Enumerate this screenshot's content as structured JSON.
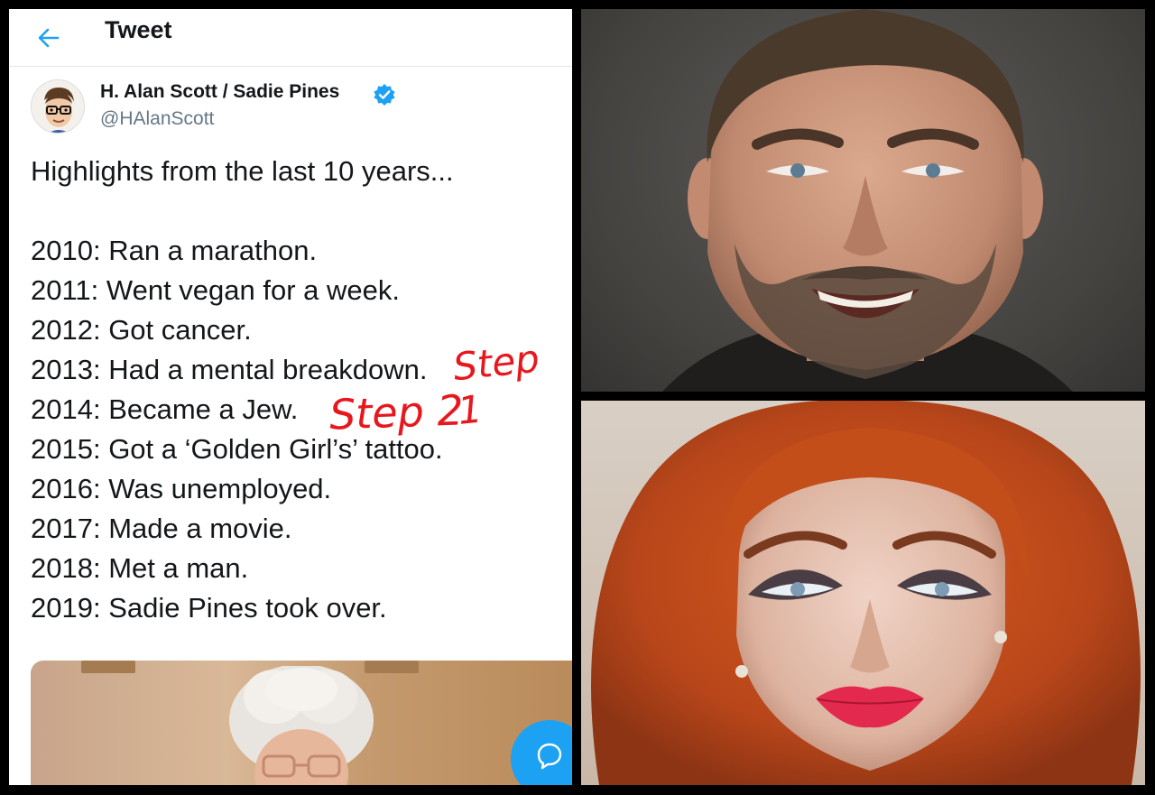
{
  "header": {
    "title": "Tweet"
  },
  "tweet": {
    "display_name": "H. Alan Scott / Sadie Pines",
    "handle": "@HAlanScott",
    "intro": "Highlights from the last 10 years...",
    "lines": [
      "2010: Ran a marathon.",
      "2011: Went vegan for a week.",
      "2012: Got cancer.",
      "2013: Had a mental breakdown.",
      "2014: Became a Jew.",
      "2015: Got a ‘Golden Girl’s’ tattoo.",
      "2016: Was unemployed.",
      "2017: Made a movie.",
      "2018: Met a man.",
      "2019: Sadie Pines took over."
    ]
  },
  "annotations": {
    "step1": "Step 1",
    "step2": "Step 2"
  },
  "colors": {
    "twitter_blue": "#1da1f2",
    "annotation_red": "#e8171d"
  },
  "icons": {
    "back": "arrow-left-icon",
    "verified": "verified-badge-icon",
    "reply": "reply-bubble-icon"
  }
}
